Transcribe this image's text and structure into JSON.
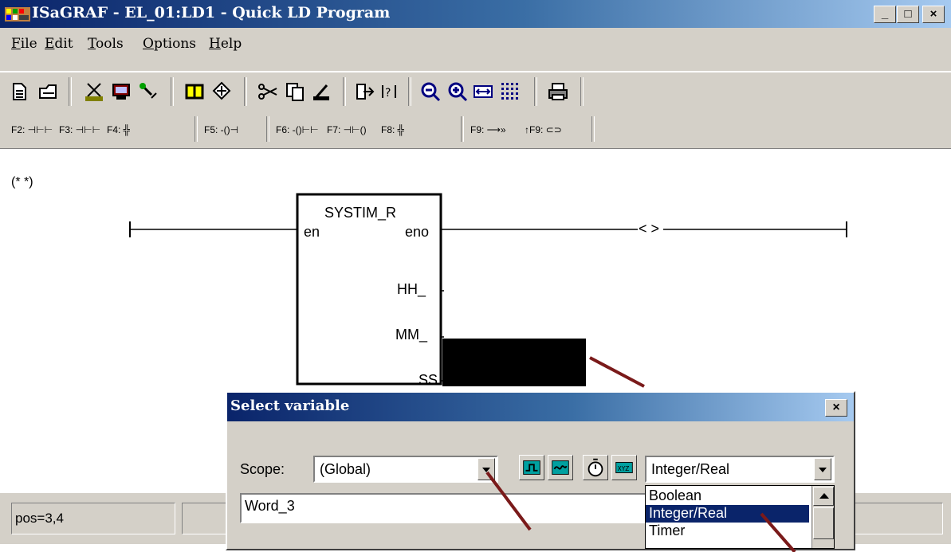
{
  "window": {
    "title": "ISaGRAF - EL_01:LD1 - Quick LD Program"
  },
  "menu": [
    {
      "key": "F",
      "rest": "ile"
    },
    {
      "key": "E",
      "rest": "dit"
    },
    {
      "key": "T",
      "rest": "ools"
    },
    {
      "key": "O",
      "rest": "ptions"
    },
    {
      "key": "H",
      "rest": "elp"
    }
  ],
  "fkeys": {
    "f2": "F2: ⊣⊢⊢",
    "f3": "F3: ⊣⊢⊢",
    "f4": "F4: ╬",
    "f5": "F5: -()⊣",
    "f6": "F6: -()⊢⊢",
    "f7": "F7: ⊣⊢()",
    "f8": "F8: ╬",
    "f9": "F9: ⟶»",
    "sf9": "↑F9: ⊂⊃"
  },
  "canvas": {
    "comment": "(* *)",
    "block_name": "SYSTIM_R",
    "pin_en": "en",
    "pin_eno": "eno",
    "pin_hh": "HH_",
    "pin_mm": "MM_",
    "pin_ss": "SS",
    "coil": "< >"
  },
  "status": {
    "pos": "pos=3,4"
  },
  "dialog": {
    "title": "Select variable",
    "scope_label": "Scope:",
    "scope_value": "(Global)",
    "type_value": "Integer/Real",
    "name_value": "Word_3",
    "type_options": [
      "Boolean",
      "Integer/Real",
      "Timer"
    ],
    "selected_index": 1
  },
  "colors": {
    "title_active": "#0a246a",
    "annotation_arrow": "#7a1a1a",
    "selection": "#0a246a"
  }
}
